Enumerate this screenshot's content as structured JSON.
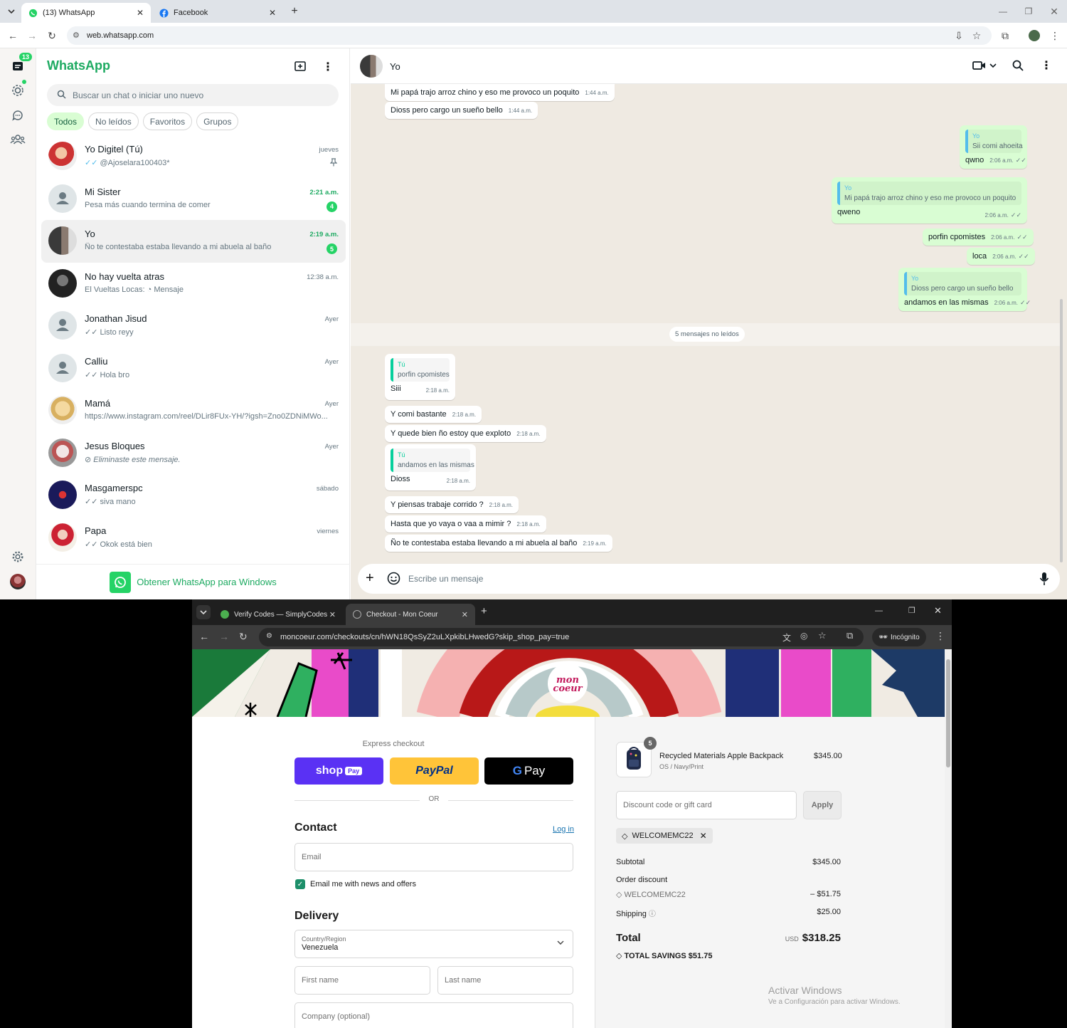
{
  "top_window": {
    "tabs": [
      {
        "label": "(13) WhatsApp",
        "active": true
      },
      {
        "label": "Facebook",
        "active": false
      }
    ],
    "url": "web.whatsapp.com",
    "rail": {
      "badge": "13"
    },
    "sidebar": {
      "title": "WhatsApp",
      "search_placeholder": "Buscar un chat o iniciar uno nuevo",
      "filters": [
        "Todos",
        "No leídos",
        "Favoritos",
        "Grupos"
      ],
      "chats": [
        {
          "name": "Yo Digitel (Tú)",
          "preview": "@Ajoselara100403*",
          "time": "jueves",
          "pinned": true
        },
        {
          "name": "Mi Sister",
          "preview": "Pesa más cuando termina de comer",
          "time": "2:21 a.m.",
          "unread": "4"
        },
        {
          "name": "Yo",
          "preview": "Ño te contestaba estaba llevando a mi abuela  al baño",
          "time": "2:19 a.m.",
          "unread": "5"
        },
        {
          "name": "No hay vuelta atras",
          "preview": "El Vueltas Locas:",
          "preview_extra": "Mensaje",
          "time": "12:38 a.m."
        },
        {
          "name": "Jonathan Jisud",
          "preview": "Listo reyy",
          "time": "Ayer"
        },
        {
          "name": "Calliu",
          "preview": "Hola bro",
          "time": "Ayer"
        },
        {
          "name": "Mamá",
          "preview": "https://www.instagram.com/reel/DLir8FUx-YH/?igsh=Zno0ZDNiMWo...",
          "time": "Ayer"
        },
        {
          "name": "Jesus Bloques",
          "preview": "Eliminaste este mensaje.",
          "time": "Ayer"
        },
        {
          "name": "Masgamerspc",
          "preview": "siva mano",
          "time": "sábado"
        },
        {
          "name": "Papa",
          "preview": "Okok está bien",
          "time": "viernes"
        }
      ],
      "get_app": "Obtener WhatsApp para Windows"
    },
    "chat": {
      "contact": "Yo",
      "messages_in_top": [
        {
          "text": "Mi papá trajo arroz chino y eso me provoco un poquito",
          "time": "1:44 a.m."
        },
        {
          "text": "Dioss pero cargo un sueño bello",
          "time": "1:44 a.m."
        }
      ],
      "messages_out": [
        {
          "quote_name": "Yo",
          "quote": "Sii comi ahoeita",
          "text": "qwno",
          "time": "2:06 a.m."
        },
        {
          "quote_name": "Yo",
          "quote": "Mi papá trajo arroz chino y eso me provoco un poquito",
          "text": "qweno",
          "time": "2:06 a.m."
        },
        {
          "text": "porfin cpomistes",
          "time": "2:06 a.m."
        },
        {
          "text": "loca",
          "time": "2:06 a.m."
        },
        {
          "quote_name": "Yo",
          "quote": "Dioss pero cargo un sueño bello",
          "text": "andamos en las mismas",
          "time": "2:06 a.m."
        }
      ],
      "unread_label": "5 mensajes no leídos",
      "messages_in": [
        {
          "quote_name": "Tú",
          "quote": "porfin cpomistes",
          "text": "Siii",
          "time": "2:18 a.m."
        },
        {
          "text": "Y comi bastante",
          "time": "2:18 a.m."
        },
        {
          "text": "Y quede bien ño estoy que exploto",
          "time": "2:18 a.m."
        },
        {
          "quote_name": "Tú",
          "quote": "andamos en las mismas",
          "text": "Dioss",
          "time": "2:18 a.m."
        },
        {
          "text": "Y piensas trabaje corrido ?",
          "time": "2:18 a.m."
        },
        {
          "text": "Hasta que yo vaya o vaa a mimir ?",
          "time": "2:18 a.m."
        },
        {
          "text": "Ño te contestaba estaba llevando a mi abuela  al baño",
          "time": "2:19 a.m."
        }
      ],
      "composer_placeholder": "Escribe un mensaje"
    }
  },
  "bottom_window": {
    "tabs": [
      {
        "label": "Verify Codes — SimplyCodes",
        "active": false
      },
      {
        "label": "Checkout - Mon Coeur",
        "active": true
      }
    ],
    "url": "moncoeur.com/checkouts/cn/hWN18QsSyZ2uLXpkibLHwedG?skip_shop_pay=true",
    "incognito": "Incógnito",
    "brand_logo_text": "mon coeur",
    "checkout": {
      "express_label": "Express checkout",
      "shop_pay": "shop",
      "shop_pay_tag": "Pay",
      "paypal": "PayPal",
      "gpay": "Pay",
      "or": "OR",
      "contact_heading": "Contact",
      "login_link": "Log in",
      "email_placeholder": "Email",
      "newsletter_label": "Email me with news and offers",
      "delivery_heading": "Delivery",
      "country_label": "Country/Region",
      "country_value": "Venezuela",
      "first_name": "First name",
      "last_name": "Last name",
      "company": "Company (optional)"
    },
    "summary": {
      "qty": "5",
      "product_name": "Recycled Materials Apple Backpack",
      "product_variant": "OS / Navy/Print",
      "product_price": "$345.00",
      "discount_placeholder": "Discount code or gift card",
      "apply": "Apply",
      "code_chip": "WELCOMEMC22",
      "subtotal_label": "Subtotal",
      "subtotal": "$345.00",
      "order_discount_label": "Order discount",
      "discount_code": "WELCOMEMC22",
      "discount_amount": "– $51.75",
      "shipping_label": "Shipping",
      "shipping": "$25.00",
      "total_label": "Total",
      "currency": "USD",
      "total": "$318.25",
      "savings_label": "TOTAL SAVINGS",
      "savings": "$51.75"
    },
    "watermark_title": "Activar Windows",
    "watermark_sub": "Ve a Configuración para activar Windows."
  }
}
